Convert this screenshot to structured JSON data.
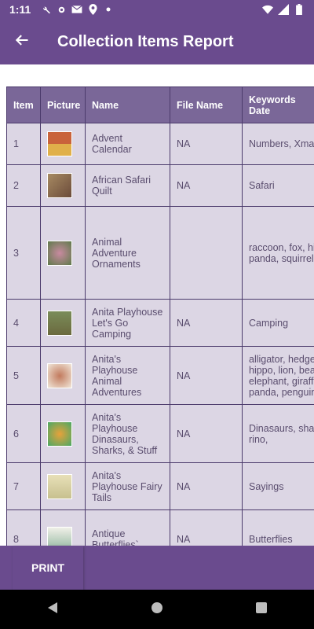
{
  "status_bar": {
    "time": "1:11",
    "icons": [
      "wrench-icon",
      "gear-icon",
      "mail-icon",
      "location-icon",
      "dot-icon",
      "wifi-icon",
      "signal-icon",
      "battery-icon"
    ]
  },
  "app_bar": {
    "title": "Collection Items Report",
    "back_icon": "arrow-back-icon"
  },
  "table": {
    "headers": {
      "item": "Item",
      "picture": "Picture",
      "name": "Name",
      "file_name": "File Name",
      "keywords": "Keywords",
      "date": "Date"
    },
    "rows": [
      {
        "item": "1",
        "name": "Advent Calendar",
        "file_name": "NA",
        "keywords": "Numbers, Xmas",
        "thumb_color": "#c9633b"
      },
      {
        "item": "2",
        "name": "African Safari Quilt",
        "file_name": "NA",
        "keywords": "Safari",
        "thumb_color": "#a78a62"
      },
      {
        "item": "3",
        "name": "Animal Adventure Ornaments",
        "file_name": "",
        "keywords": "raccoon, fox, hippo, panda, squirrel",
        "thumb_color": "#5f7a4b"
      },
      {
        "item": "4",
        "name": "Anita Playhouse Let's Go Camping",
        "file_name": "NA",
        "keywords": "Camping",
        "thumb_color": "#6b6a3e"
      },
      {
        "item": "5",
        "name": "Anita's Playhouse Animal Adventures",
        "file_name": "NA",
        "keywords": "alligator, hedgehog, hippo, lion, bear, elephant, giraffe, panda, penguin",
        "thumb_color": "#c27a5d"
      },
      {
        "item": "6",
        "name": "Anita's Playhouse Dinasaurs, Sharks, & Stuff",
        "file_name": "NA",
        "keywords": "Dinasaurs, sharks, rino,",
        "thumb_color": "#4aa865"
      },
      {
        "item": "7",
        "name": "Anita's Playhouse Fairy Tails",
        "file_name": "NA",
        "keywords": "Sayings",
        "thumb_color": "#c7c08f"
      },
      {
        "item": "8",
        "name": "Antique Butterflies`",
        "file_name": "NA",
        "keywords": "Butterflies",
        "thumb_color": "#8fb59d"
      }
    ]
  },
  "bottom_bar": {
    "print_label": "PRINT"
  },
  "nav_bar": {
    "icons": [
      "back-triangle-icon",
      "home-circle-icon",
      "recents-square-icon"
    ]
  }
}
